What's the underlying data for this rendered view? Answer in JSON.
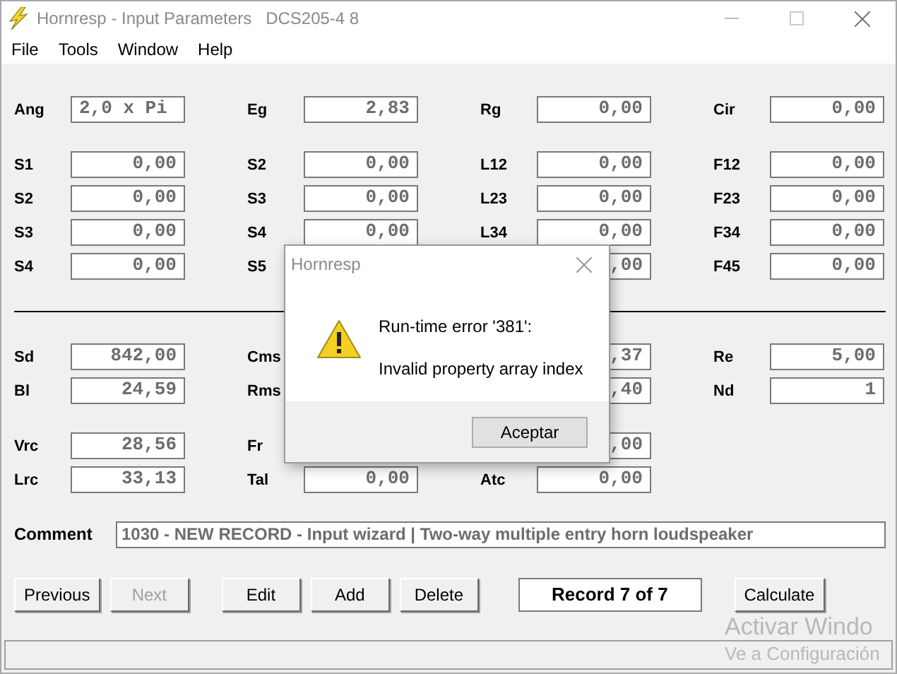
{
  "window": {
    "title": "Hornresp - Input Parameters   DCS205-4 8"
  },
  "menu": [
    "File",
    "Tools",
    "Window",
    "Help"
  ],
  "rows": [
    {
      "kind": "fields",
      "spaced": false,
      "cells": [
        {
          "label": "Ang",
          "value": "2,0 x Pi",
          "left_aligned": true
        },
        {
          "label": "Eg",
          "value": "2,83"
        },
        {
          "label": "Rg",
          "value": "0,00"
        },
        {
          "label": "Cir",
          "value": "0,00"
        }
      ]
    },
    {
      "kind": "fields",
      "spaced": true,
      "cells": [
        {
          "label": "S1",
          "value": "0,00"
        },
        {
          "label": "S2",
          "value": "0,00"
        },
        {
          "label": "L12",
          "value": "0,00"
        },
        {
          "label": "F12",
          "value": "0,00"
        }
      ]
    },
    {
      "kind": "fields",
      "spaced": false,
      "cells": [
        {
          "label": "S2",
          "value": "0,00"
        },
        {
          "label": "S3",
          "value": "0,00"
        },
        {
          "label": "L23",
          "value": "0,00"
        },
        {
          "label": "F23",
          "value": "0,00"
        }
      ]
    },
    {
      "kind": "fields",
      "spaced": false,
      "cells": [
        {
          "label": "S3",
          "value": "0,00"
        },
        {
          "label": "S4",
          "value": "0,00"
        },
        {
          "label": "L34",
          "value": "0,00"
        },
        {
          "label": "F34",
          "value": "0,00"
        }
      ]
    },
    {
      "kind": "fields",
      "spaced": false,
      "cells": [
        {
          "label": "S4",
          "value": "0,00"
        },
        {
          "label": "S5"
        },
        {
          "value": ",00"
        },
        {
          "label": "F45",
          "value": "0,00"
        }
      ]
    },
    {
      "kind": "divider"
    },
    {
      "kind": "fields",
      "spaced": false,
      "cells": [
        {
          "label": "Sd",
          "value": "842,00"
        },
        {
          "label": "Cms"
        },
        {
          "value": ",37"
        },
        {
          "label": "Re",
          "value": "5,00"
        }
      ]
    },
    {
      "kind": "fields",
      "spaced": false,
      "cells": [
        {
          "label": "Bl",
          "value": "24,59"
        },
        {
          "label": "Rms"
        },
        {
          "value": ",40"
        },
        {
          "label": "Nd",
          "value": "1"
        }
      ]
    },
    {
      "kind": "fields",
      "spaced": true,
      "cells": [
        {
          "label": "Vrc",
          "value": "28,56"
        },
        {
          "label": "Fr"
        },
        {
          "value": ",00"
        },
        {}
      ]
    },
    {
      "kind": "fields",
      "spaced": false,
      "cells": [
        {
          "label": "Lrc",
          "value": "33,13"
        },
        {
          "label": "Tal",
          "value": "0,00"
        },
        {
          "label": "Atc",
          "value": "0,00"
        },
        {}
      ]
    }
  ],
  "comment": {
    "label": "Comment",
    "value": "1030 - NEW RECORD - Input wizard | Two-way multiple entry horn loudspeaker"
  },
  "buttons": [
    {
      "kind": "button",
      "label": "Previous",
      "disabled": false
    },
    {
      "kind": "button",
      "label": "Next",
      "disabled": true
    },
    {
      "kind": "spacer"
    },
    {
      "kind": "button",
      "label": "Edit",
      "disabled": false
    },
    {
      "kind": "button",
      "label": "Add",
      "disabled": false
    },
    {
      "kind": "button",
      "label": "Delete",
      "disabled": false
    },
    {
      "kind": "record",
      "label": "Record 7 of 7"
    },
    {
      "kind": "button",
      "label": "Calculate",
      "disabled": false
    }
  ],
  "dialog": {
    "title": "Hornresp",
    "lines": [
      "Run-time error '381':",
      "Invalid property array index"
    ],
    "button": "Aceptar"
  },
  "activation": [
    "Activar Windo",
    "Ve a Configuración"
  ]
}
